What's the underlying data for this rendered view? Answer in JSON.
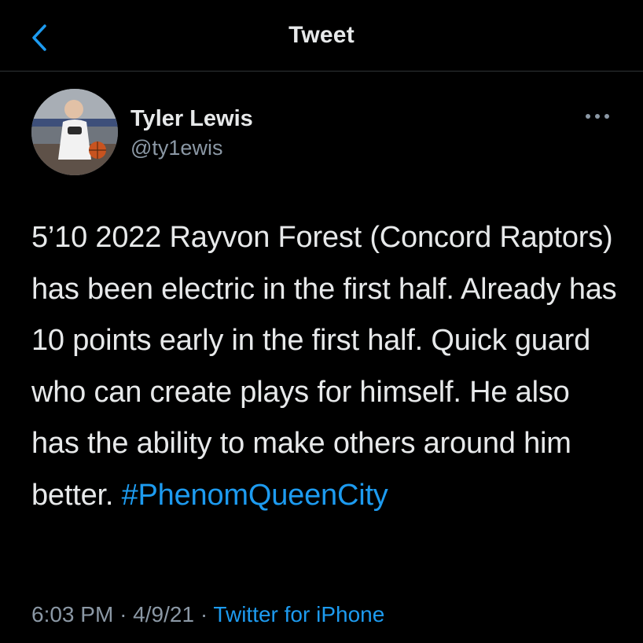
{
  "colors": {
    "background": "#000000",
    "text": "#e7e9ea",
    "secondary_text": "#8b98a5",
    "accent": "#1d9bf0",
    "divider": "#2f3336"
  },
  "nav": {
    "back_icon": "chevron-left-icon",
    "title": "Tweet"
  },
  "author": {
    "name": "Tyler Lewis",
    "handle": "@ty1ewis",
    "more_icon": "more-horizontal-icon"
  },
  "tweet": {
    "text": "5’10  2022  Rayvon Forest (Concord Raptors) has been electric in the first half. Already has 10 points early in the first half. Quick guard who can create plays for himself. He also has the ability to make others around him better.",
    "hashtag": "#PhenomQueenCity"
  },
  "meta": {
    "time": "6:03 PM",
    "separator": "·",
    "date": "4/9/21",
    "source": "Twitter for iPhone"
  }
}
